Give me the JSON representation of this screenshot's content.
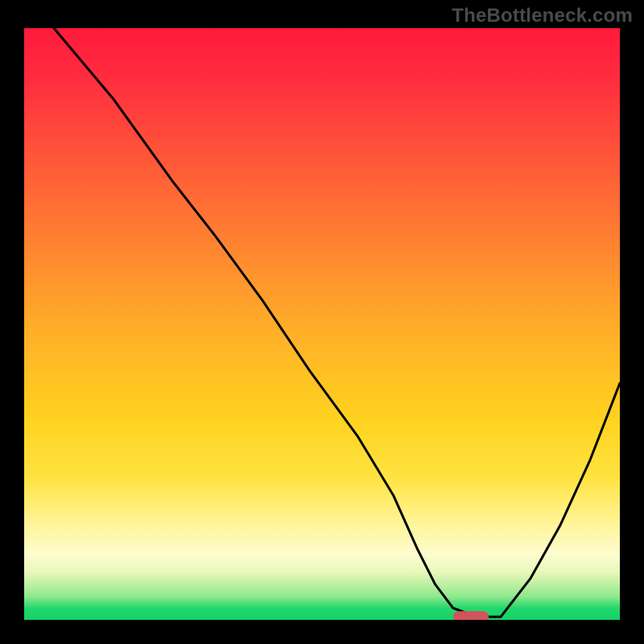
{
  "watermark": "TheBottleneck.com",
  "chart_data": {
    "type": "line",
    "title": "",
    "xlabel": "",
    "ylabel": "",
    "xlim": [
      0,
      100
    ],
    "ylim": [
      0,
      100
    ],
    "grid": false,
    "legend": false,
    "series": [
      {
        "name": "bottleneck-curve",
        "x": [
          5,
          15,
          25,
          32,
          40,
          48,
          56,
          62,
          66,
          69,
          72,
          76,
          80,
          85,
          90,
          95,
          100
        ],
        "y": [
          100,
          88,
          74,
          65,
          54,
          42,
          31,
          21,
          12,
          6,
          2,
          0.5,
          0.5,
          7,
          16,
          27,
          40
        ]
      }
    ],
    "marker": {
      "name": "optimal-point",
      "x_range": [
        72,
        78
      ],
      "y": 0.5,
      "color": "#d0545a"
    },
    "background_gradient": {
      "stops": [
        {
          "pos": 0,
          "color": "#ff1a3c"
        },
        {
          "pos": 50,
          "color": "#ffb128"
        },
        {
          "pos": 85,
          "color": "#fff59b"
        },
        {
          "pos": 100,
          "color": "#13d167"
        }
      ]
    }
  }
}
